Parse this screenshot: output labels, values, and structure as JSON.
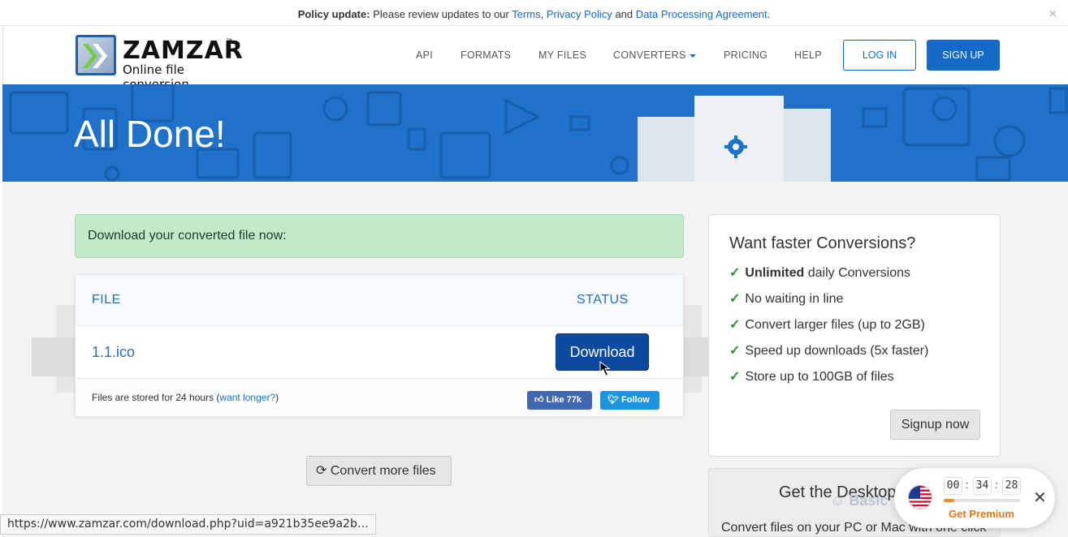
{
  "policy": {
    "bold": "Policy update:",
    "text": "Please review updates to our",
    "link_terms": "Terms",
    "comma": ",",
    "link_privacy": "Privacy Policy",
    "and": "and",
    "link_dpa": "Data Processing Agreement",
    "period": ".",
    "close": "×"
  },
  "header": {
    "logo_name": "ZAMZAR",
    "logo_tm": "™",
    "logo_sub": "Online file conversion",
    "nav": [
      "API",
      "FORMATS",
      "MY FILES",
      "CONVERTERS",
      "PRICING",
      "HELP"
    ],
    "login": "LOG IN",
    "signup": "SIGN UP"
  },
  "banner": {
    "title": "All Done!"
  },
  "main": {
    "alert": "Download your converted file now:",
    "col_file": "FILE",
    "col_status": "STATUS",
    "file_name": "1.1.ico",
    "download": "Download",
    "stored_text": "Files are stored for 24 hours (",
    "want_longer": "want longer?",
    "stored_close": ")",
    "like": "Like 77k",
    "follow": "Follow",
    "convert_more": "Convert more files"
  },
  "sidebar": {
    "title": "Want faster Conversions?",
    "items": [
      {
        "bold": "Unlimited",
        "text": " daily Conversions"
      },
      {
        "bold": "",
        "text": "No waiting in line"
      },
      {
        "bold": "",
        "text": "Convert larger files (up to 2GB)"
      },
      {
        "bold": "",
        "text": "Speed up downloads (5x faster)"
      },
      {
        "bold": "",
        "text": "Store up to 100GB of files"
      }
    ],
    "check": "✓",
    "signup_now": "Signup now",
    "desktop_title": "Get the Desktop",
    "desktop_text": "Convert files on your PC or Mac with one click"
  },
  "widget": {
    "hours": "00",
    "minutes": "34",
    "seconds": "28",
    "sep": ":",
    "progress": 0.14,
    "premium": "Get Premium",
    "close": "✕",
    "basic": "Basic"
  },
  "status_url": "https://www.zamzar.com/download.php?uid=a921b35ee9a2b…",
  "colors": {
    "brand_blue": "#1569c7",
    "download_blue": "#0b4a9c",
    "alert_green": "#c3e9cb",
    "premium_orange": "#e0781a"
  }
}
